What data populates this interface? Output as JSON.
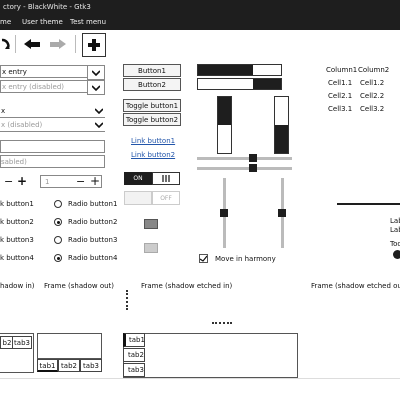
{
  "window": {
    "title": "ctory - BlackWhite - Gtk3"
  },
  "menu": {
    "item1": "me",
    "item2": "User theme",
    "item3": "Test menu"
  },
  "combos": [
    {
      "text": "x entry"
    },
    {
      "text": "x entry (disabled)"
    },
    {
      "text": "x"
    },
    {
      "text": "x (disabled)"
    }
  ],
  "entries": {
    "entry2": "sabled)"
  },
  "spinners": {
    "value": "1"
  },
  "buttons": {
    "b1": "Button1",
    "b2": "Button2",
    "t1": "Toggle button1",
    "t2": "Toggle button2"
  },
  "links": {
    "l1": "Link button1",
    "l2": "Link button2"
  },
  "switches": {
    "on": "ON",
    "off": "OFF"
  },
  "checks": [
    {
      "label": "k button1"
    },
    {
      "label": "k button2"
    },
    {
      "label": "k button3"
    },
    {
      "label": "k button4"
    }
  ],
  "radios": [
    {
      "label": "Radio button1",
      "checked": false
    },
    {
      "label": "Radio button2",
      "checked": true
    },
    {
      "label": "Radio button3",
      "checked": false
    },
    {
      "label": "Radio button4",
      "checked": false
    }
  ],
  "harmony": {
    "label": "Move in harmony",
    "checked": true
  },
  "table": {
    "headers": [
      "Column1",
      "Column2"
    ],
    "rows": [
      [
        "Cell1.1",
        "Cell1.2"
      ],
      [
        "Cell2.1",
        "Cell2.2"
      ],
      [
        "Cell3.1",
        "Cell3.2"
      ]
    ]
  },
  "right_labels": {
    "lab1": "Lab",
    "lab2": "Lab",
    "too": "Too"
  },
  "frames": {
    "f1": "hadow in)",
    "f2": "Frame (shadow out)",
    "f3": "Frame (shadow etched in)",
    "f4": "Frame (shadow etched out"
  },
  "tabs": {
    "left": [
      "b2",
      "tab3"
    ],
    "bottom": [
      "tab1",
      "tab2",
      "tab3"
    ],
    "side": [
      "tab1",
      "tab2",
      "tab3"
    ]
  },
  "colors": {
    "dark": "#1e1e1e",
    "link": "#2255aa"
  }
}
